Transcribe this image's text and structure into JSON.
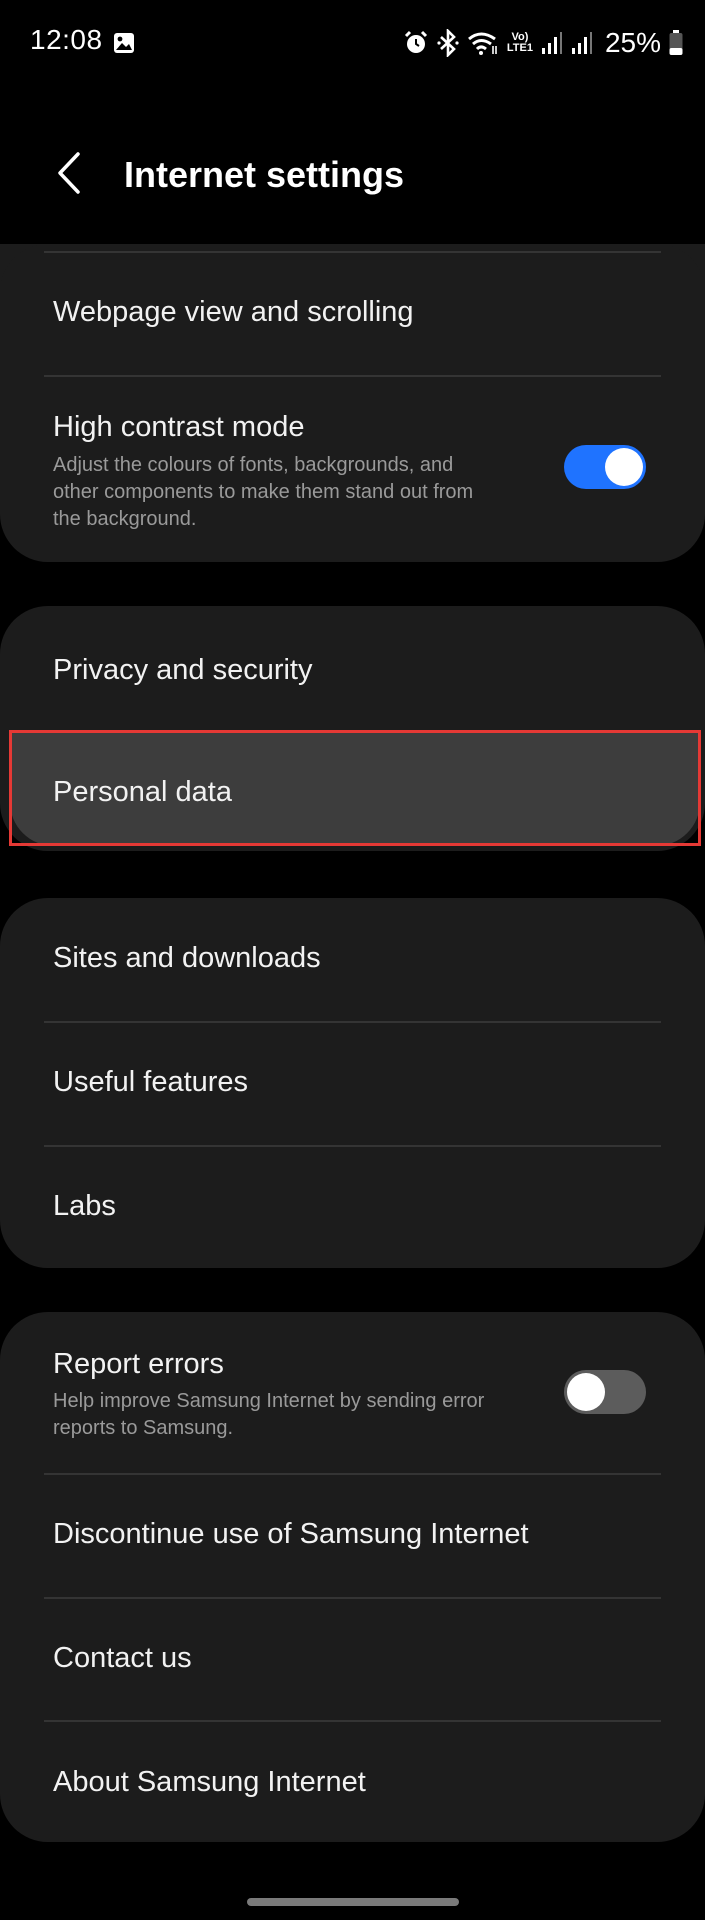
{
  "status_bar": {
    "time": "12:08",
    "battery": "25%",
    "icons": [
      "gallery-icon",
      "alarm-icon",
      "bluetooth-icon",
      "wifi-icon",
      "volte-icon",
      "signal-icon",
      "signal-icon-2",
      "battery-icon"
    ],
    "volte_top": "Vo)",
    "volte_bottom": "LTE1"
  },
  "app_bar": {
    "title": "Internet settings",
    "back_icon": "chevron-left-icon"
  },
  "groups": {
    "display": {
      "webpage_view": "Webpage view and scrolling",
      "high_contrast": {
        "label": "High contrast mode",
        "description": "Adjust the colours of fonts, backgrounds, and other components to make them stand out from the background.",
        "enabled": true
      }
    },
    "privacy": {
      "privacy_security": "Privacy and security",
      "personal_data": "Personal data"
    },
    "features": {
      "sites_downloads": "Sites and downloads",
      "useful_features": "Useful features",
      "labs": "Labs"
    },
    "about": {
      "report_errors": {
        "label": "Report errors",
        "description": "Help improve Samsung Internet by sending error reports to Samsung.",
        "enabled": false
      },
      "discontinue": "Discontinue use of Samsung Internet",
      "contact": "Contact us",
      "about": "About Samsung Internet"
    }
  },
  "colors": {
    "background": "#000000",
    "card": "#1c1c1c",
    "highlight": "#3d3d3d",
    "toggle_on": "#1f73ff",
    "toggle_off": "#5c5c5c",
    "annotation_frame": "#e53935"
  }
}
